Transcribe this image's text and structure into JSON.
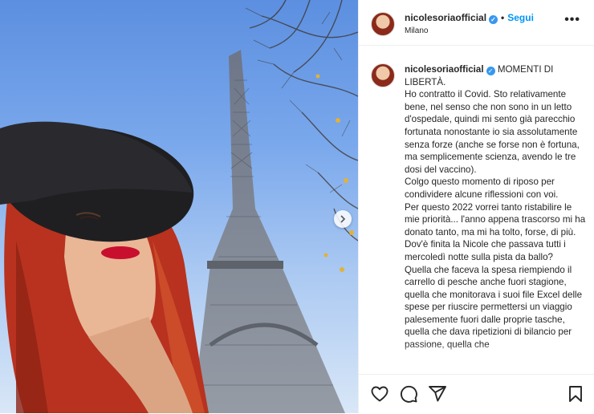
{
  "post": {
    "username": "nicolesoriaofficial",
    "follow_label": "Segui",
    "separator": "•",
    "location": "Milano",
    "more_label": "•••",
    "caption": "MOMENTI DI LIBERTÀ.\nHo contratto il Covid. Sto relativamente bene, nel senso che non sono in un letto d'ospedale, quindi mi sento già parecchio fortunata nonostante io sia assolutamente senza forze (anche se forse non è fortuna, ma semplicemente scienza, avendo le tre dosi del vaccino).\nColgo questo momento di riposo per condividere alcune riflessioni con voi.\nPer questo 2022 vorrei tanto ristabilire le mie priorità... l'anno appena trascorso mi ha donato tanto, ma mi ha tolto, forse, di più.\nDov'è finita la Nicole che passava tutti i mercoledì notte sulla pista da ballo?\nQuella che faceva la spesa riempiendo il carrello di pesche anche fuori stagione, quella che monitorava i suoi file Excel delle spese per riuscire permettersi un viaggio palesemente fuori dalle proprie tasche, quella che dava ripetizioni di bilancio per passione, quella che"
  },
  "icons": {
    "like": "heart-icon",
    "comment": "comment-icon",
    "share": "share-icon",
    "save": "bookmark-icon",
    "next": "chevron-right-icon"
  },
  "colors": {
    "follow": "#0095f6",
    "verified": "#3897f0",
    "lipstick": "#c8102e",
    "hair": "#b8321f"
  }
}
